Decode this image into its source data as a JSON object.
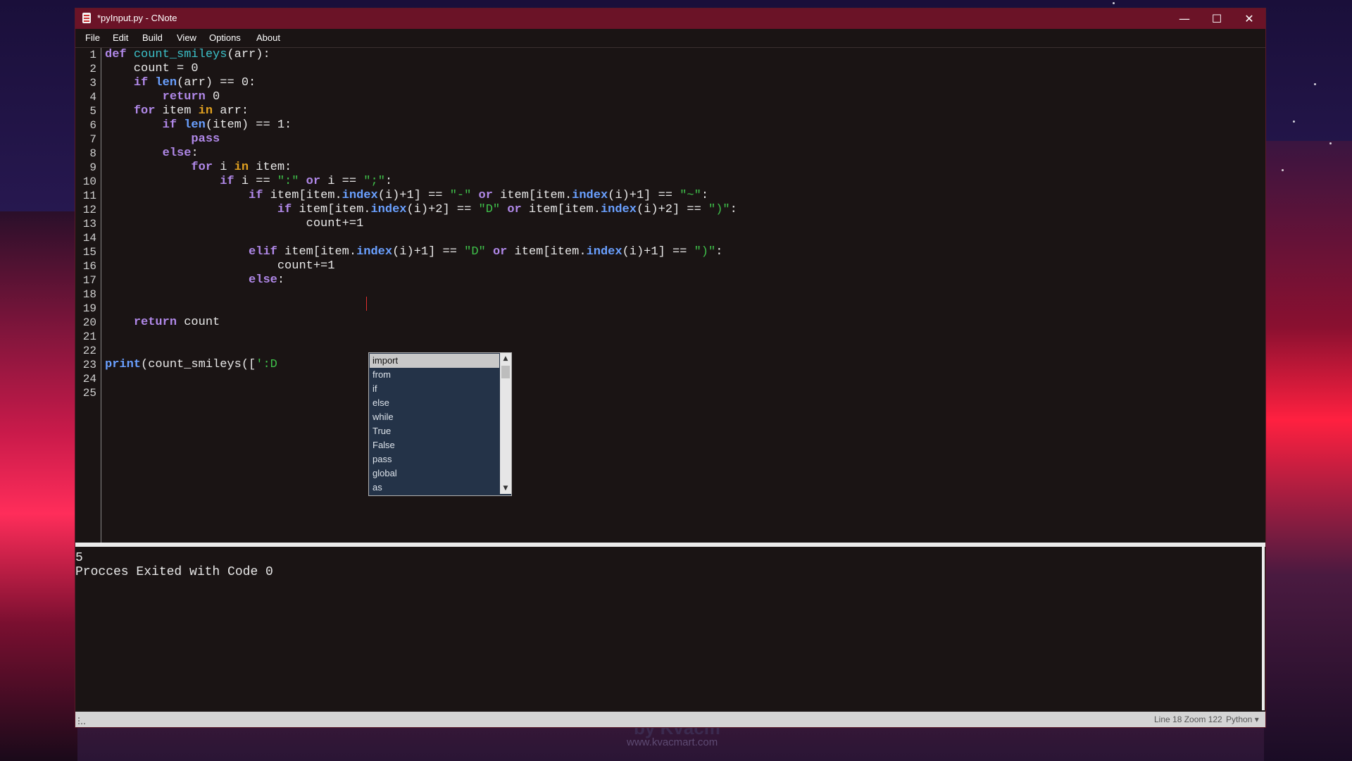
{
  "window": {
    "title": "*pyInput.py - CNote",
    "controls": {
      "minimize": "—",
      "maximize": "☐",
      "close": "✕"
    }
  },
  "menu": [
    "File",
    "Edit",
    "Build",
    "View",
    "Options",
    "About"
  ],
  "editor": {
    "line_numbers": [
      "1",
      "2",
      "3",
      "4",
      "5",
      "6",
      "7",
      "8",
      "9",
      "10",
      "11",
      "12",
      "13",
      "14",
      "15",
      "16",
      "17",
      "18",
      "19",
      "20",
      "21",
      "22",
      "23",
      "24",
      "25"
    ],
    "language": "python",
    "cursor_line": 18
  },
  "autocomplete": {
    "items": [
      "import",
      "from",
      "if",
      "else",
      "while",
      "True",
      "False",
      "pass",
      "global",
      "as"
    ],
    "selected": "import"
  },
  "output": {
    "lines": [
      "5",
      "Procces Exited with Code 0"
    ]
  },
  "status": {
    "line_zoom": "Line 18 Zoom 122",
    "language": "Python ▾"
  },
  "wallpaper": {
    "watermark": "www.kvacmart.com"
  }
}
